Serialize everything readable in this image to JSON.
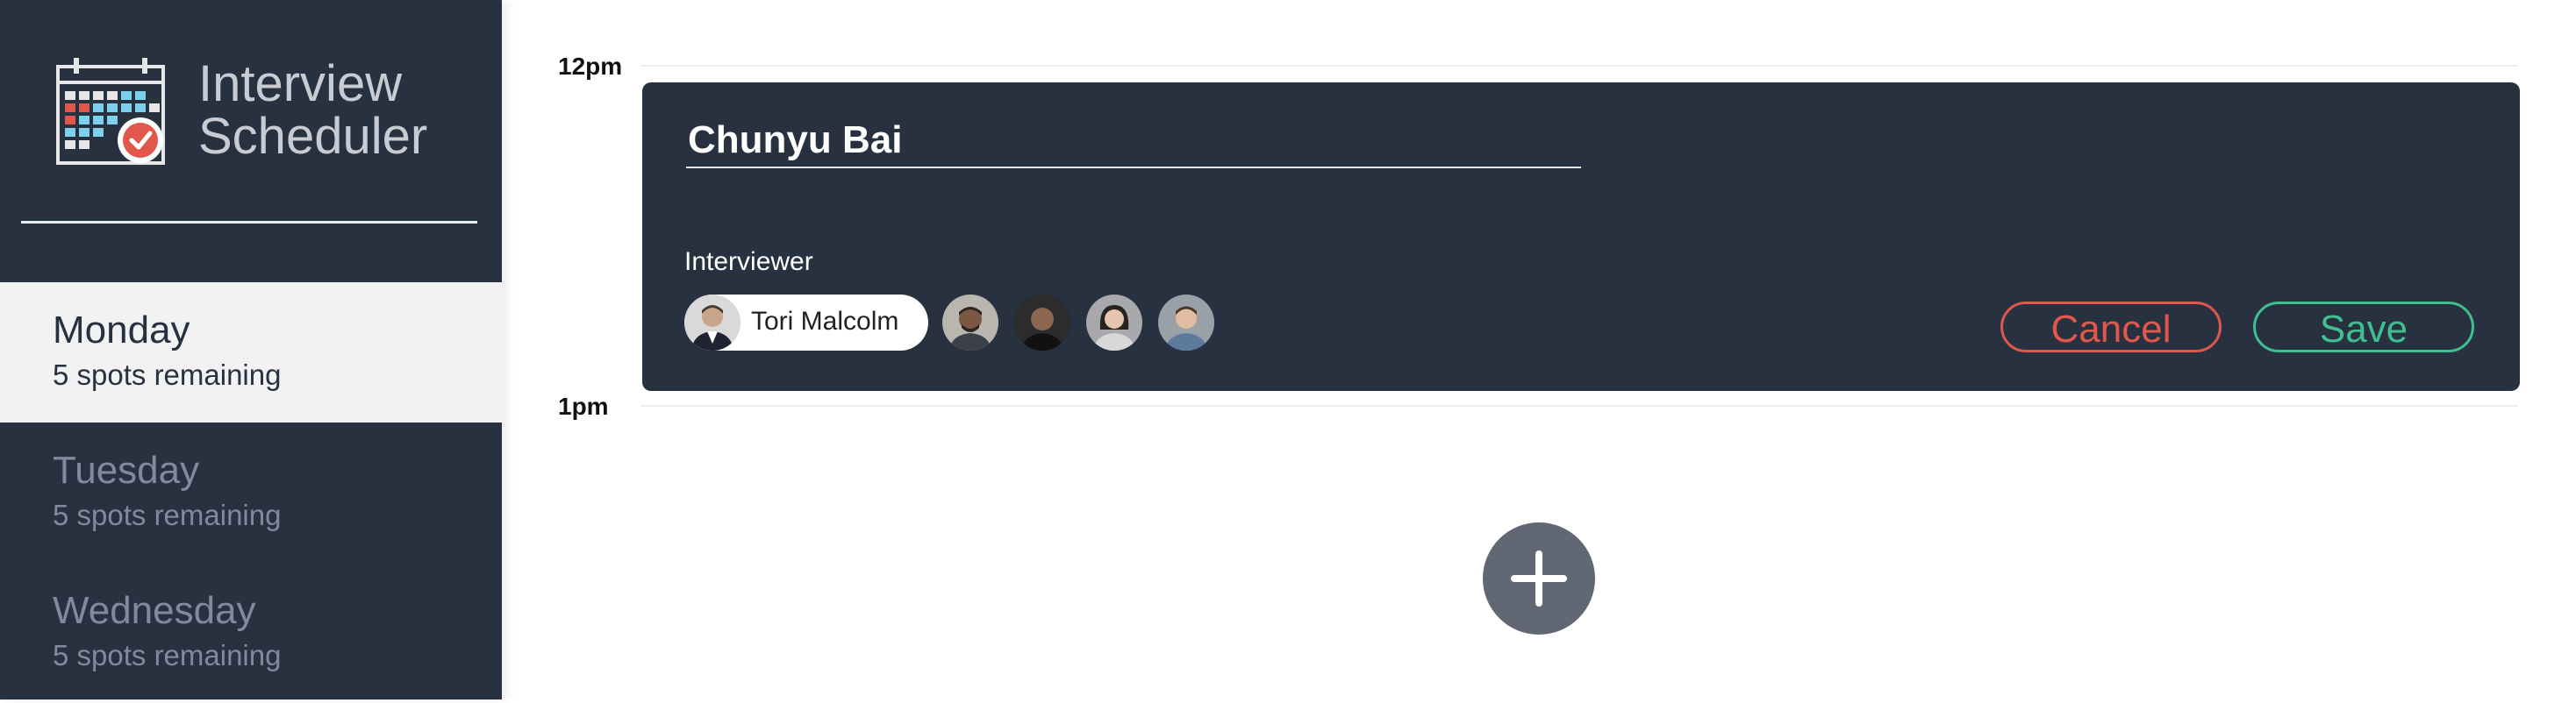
{
  "app": {
    "title_line1": "Interview",
    "title_line2": "Scheduler"
  },
  "days": [
    {
      "name": "Monday",
      "spots": "5 spots remaining",
      "selected": true
    },
    {
      "name": "Tuesday",
      "spots": "5 spots remaining",
      "selected": false
    },
    {
      "name": "Wednesday",
      "spots": "5 spots remaining",
      "selected": false
    }
  ],
  "schedule": {
    "times": [
      "12pm",
      "1pm"
    ],
    "form": {
      "student_name": "Chunyu Bai",
      "interviewer_label": "Interviewer",
      "selected_interviewer": "Tori Malcolm",
      "cancel_label": "Cancel",
      "save_label": "Save"
    }
  },
  "colors": {
    "sidebar_bg": "#283140",
    "card_bg": "#283140",
    "cancel": "#e0574b",
    "save": "#3fbf8f",
    "add_button": "#626873"
  },
  "icons": [
    "calendar-check-icon",
    "plus-icon"
  ]
}
